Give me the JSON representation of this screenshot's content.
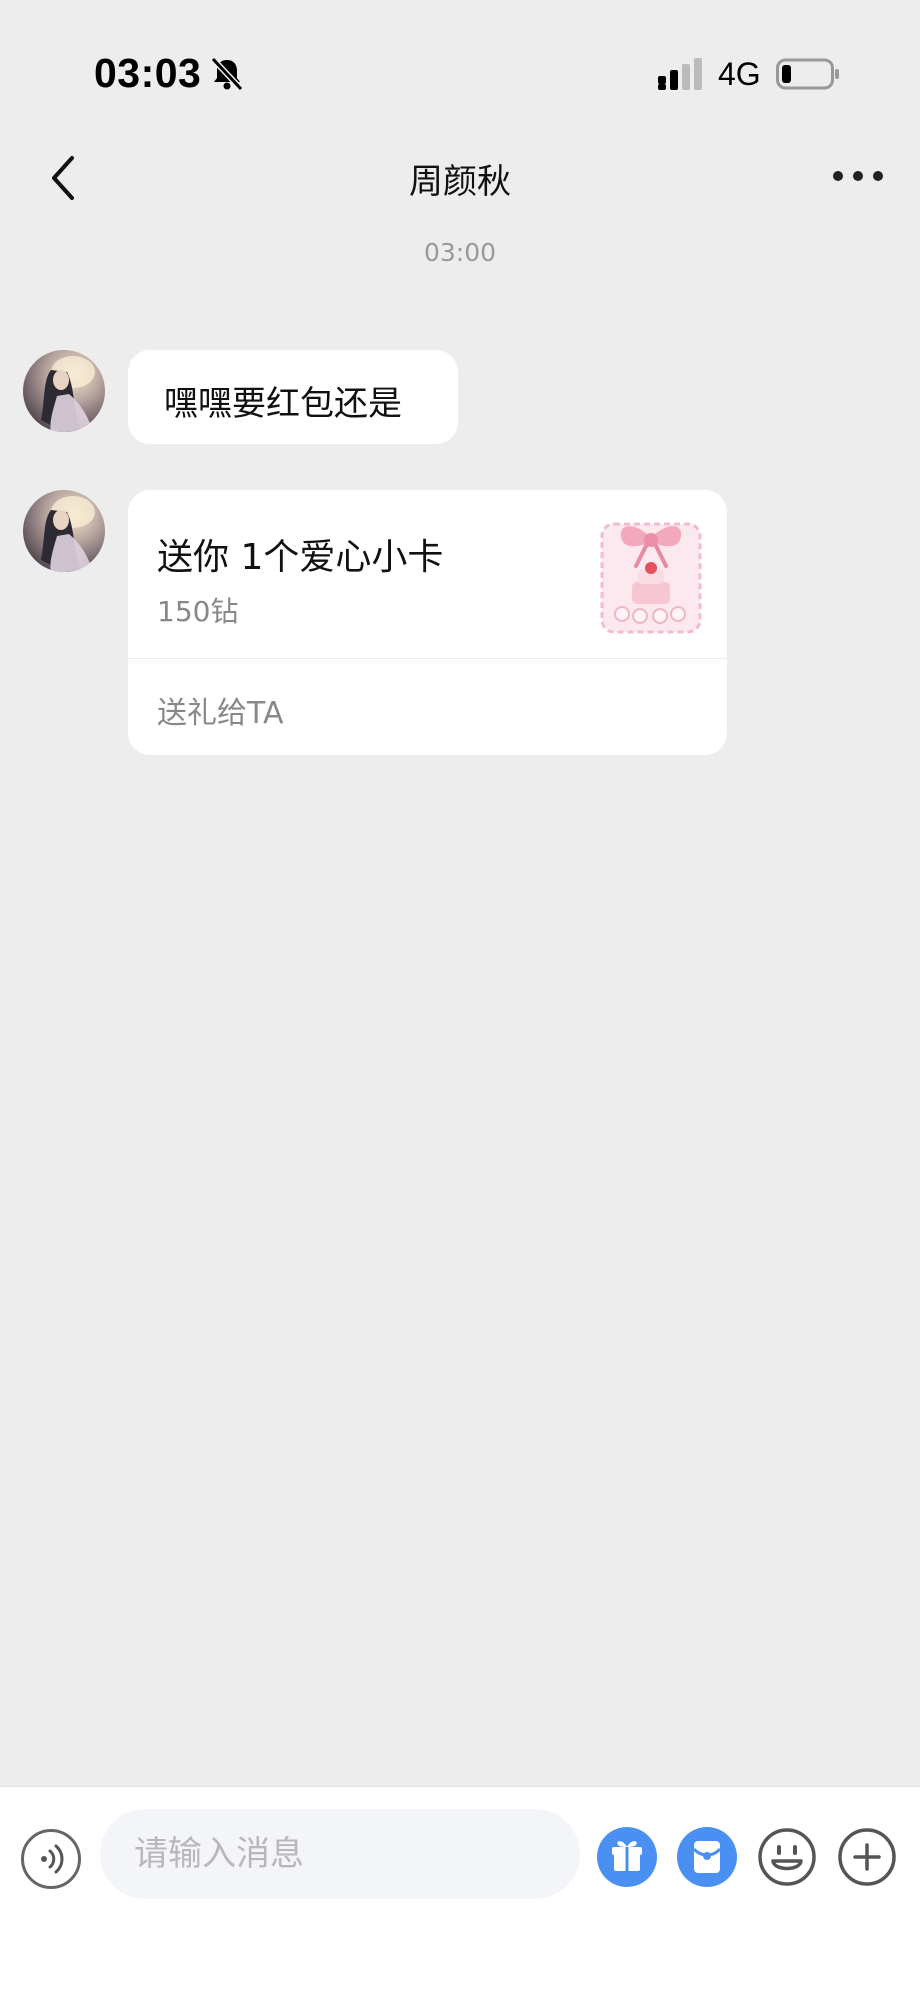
{
  "status_bar": {
    "time": "03:03",
    "network": "4G",
    "icons": [
      "bell-muted-icon",
      "signal-icon",
      "battery-icon"
    ]
  },
  "nav": {
    "title": "周颜秋",
    "back_icon": "chevron-left-icon",
    "more_icon": "more-dots-icon"
  },
  "conversation": {
    "timestamp": "03:00",
    "messages": [
      {
        "type": "text",
        "text": "嘿嘿要红包还是"
      },
      {
        "type": "gift",
        "title": "送你 1个爱心小卡",
        "price": "150钻",
        "action": "送礼给TA",
        "image": "gift-cake-bow-icon"
      }
    ]
  },
  "input_bar": {
    "placeholder": "请输入消息",
    "value": "",
    "buttons": [
      "voice-icon",
      "gift-icon",
      "red-packet-icon",
      "emoji-icon",
      "plus-icon"
    ]
  },
  "colors": {
    "background": "#ededed",
    "accent_blue": "#4a90f3",
    "bubble": "#ffffff",
    "muted_text": "#888888"
  }
}
